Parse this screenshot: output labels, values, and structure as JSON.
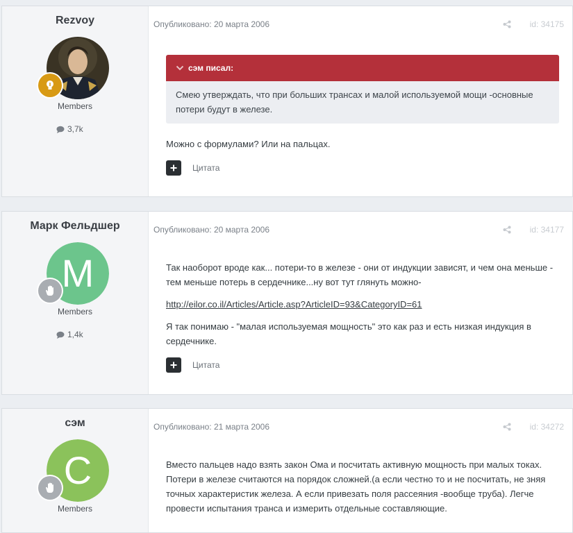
{
  "posts": [
    {
      "author": "Rezvoy",
      "group": "Members",
      "post_count": "3,7k",
      "published": "Опубликовано: 20 марта 2006",
      "post_id": "id: 34175",
      "quote": {
        "header": "сэм писал:",
        "text": "Смею утверждать, что при больших трансах и малой используемой мощи -основные потери будут в железе."
      },
      "body": "Можно с формулами? Или на пальцах.",
      "quote_button": "Цитата"
    },
    {
      "author": "Марк Фельдшер",
      "group": "Members",
      "post_count": "1,4k",
      "avatar_letter": "M",
      "avatar_color": "#6cc58c",
      "published": "Опубликовано: 20 марта 2006",
      "post_id": "id: 34177",
      "body_p1": "Так наоборот вроде как... потери-то в железе - они от индукции зависят, и чем она меньше - тем меньше потерь в сердечнике...ну вот тут глянуть можно-",
      "link": "http://eilor.co.il/Articles/Article.asp?ArticleID=93&CategoryID=61",
      "body_p2": "Я так понимаю - \"малая используемая мощность\" это как раз и есть низкая индукция в сердечнике.",
      "quote_button": "Цитата"
    },
    {
      "author": "сэм",
      "group": "Members",
      "avatar_letter": "C",
      "avatar_color": "#8bc25b",
      "published": "Опубликовано: 21 марта 2006",
      "post_id": "id: 34272",
      "body": "Вместо пальцев надо взять закон Ома и посчитать активную мощность при малых токах. Потери в железе считаются на порядок сложней.(а если честно то и не посчитать, не зняя точных характеристик железа. А если привезать поля рассеяния -вообще труба). Легче провести испытания транса и измерить отдельные составляющие."
    }
  ],
  "colors": {
    "quote_header": "#b4303a",
    "badge_gold": "#d89a14",
    "badge_grey": "#a9adb2"
  }
}
